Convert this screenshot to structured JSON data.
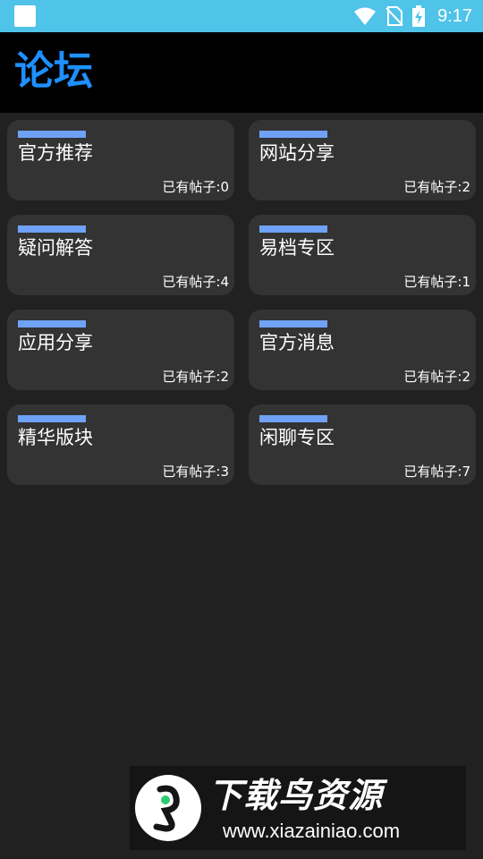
{
  "status_bar": {
    "time": "9:17",
    "icons": [
      "app-notification-icon",
      "wifi-icon",
      "no-sim-icon",
      "battery-charging-icon"
    ]
  },
  "header": {
    "title": "论坛"
  },
  "forums": [
    {
      "name": "官方推荐",
      "count_label": "已有帖子:0"
    },
    {
      "name": "网站分享",
      "count_label": "已有帖子:2"
    },
    {
      "name": "疑问解答",
      "count_label": "已有帖子:4"
    },
    {
      "name": "易档专区",
      "count_label": "已有帖子:1"
    },
    {
      "name": "应用分享",
      "count_label": "已有帖子:2"
    },
    {
      "name": "官方消息",
      "count_label": "已有帖子:2"
    },
    {
      "name": "精华版块",
      "count_label": "已有帖子:3"
    },
    {
      "name": "闲聊专区",
      "count_label": "已有帖子:7"
    }
  ],
  "watermark": {
    "title": "下载鸟资源",
    "url": "www.xiazainiao.com"
  },
  "colors": {
    "status_bar": "#4fc3e8",
    "app_bar": "#000000",
    "title_accent": "#1e90ff",
    "background": "#212121",
    "card": "#333333",
    "card_bar": "#6fa2f7"
  }
}
